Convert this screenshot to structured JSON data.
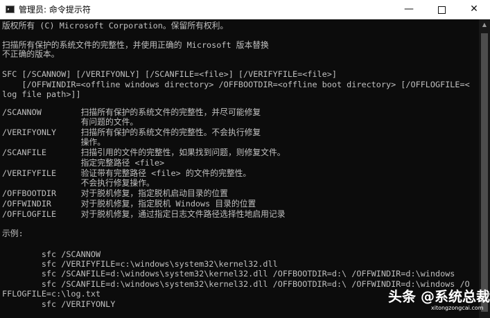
{
  "window": {
    "title": "管理员: 命令提示符",
    "min_label": "—",
    "close_label": "✕"
  },
  "console": {
    "lines": [
      "版权所有 (C) Microsoft Corporation。保留所有权利。",
      "",
      "扫描所有保护的系统文件的完整性，并使用正确的 Microsoft 版本替换",
      "不正确的版本。",
      "",
      "SFC [/SCANNOW] [/VERIFYONLY] [/SCANFILE=<file>] [/VERIFYFILE=<file>]",
      "    [/OFFWINDIR=<offline windows directory> /OFFBOOTDIR=<offline boot directory> [/OFFLOGFILE=<",
      "log file path>]]",
      "",
      "/SCANNOW        扫描所有保护的系统文件的完整性，并尽可能修复",
      "                有问题的文件。",
      "/VERIFYONLY     扫描所有保护的系统文件的完整性。不会执行修复",
      "                操作。",
      "/SCANFILE       扫描引用的文件的完整性，如果找到问题，则修复文件。",
      "                指定完整路径 <file>",
      "/VERIFYFILE     验证带有完整路径 <file> 的文件的完整性。",
      "                不会执行修复操作。",
      "/OFFBOOTDIR     对于脱机修复，指定脱机启动目录的位置",
      "/OFFWINDIR      对于脱机修复，指定脱机 Windows 目录的位置",
      "/OFFLOGFILE     对于脱机修复，通过指定日志文件路径选择性地启用记录",
      "",
      "示例:",
      "",
      "        sfc /SCANNOW",
      "        sfc /VERIFYFILE=c:\\windows\\system32\\kernel32.dll",
      "        sfc /SCANFILE=d:\\windows\\system32\\kernel32.dll /OFFBOOTDIR=d:\\ /OFFWINDIR=d:\\windows",
      "        sfc /SCANFILE=d:\\windows\\system32\\kernel32.dll /OFFBOOTDIR=d:\\ /OFFWINDIR=d:\\windows /O",
      "FFLOGFILE=c:\\log.txt",
      "        sfc /VERIFYONLY"
    ]
  },
  "watermark": {
    "text": "头条 @系统总裁",
    "url": "xitongzongcai.com"
  },
  "colors": {
    "console_bg": "#0c0c0c",
    "console_text": "#c0c0c0",
    "titlebar_bg": "#ffffff"
  }
}
